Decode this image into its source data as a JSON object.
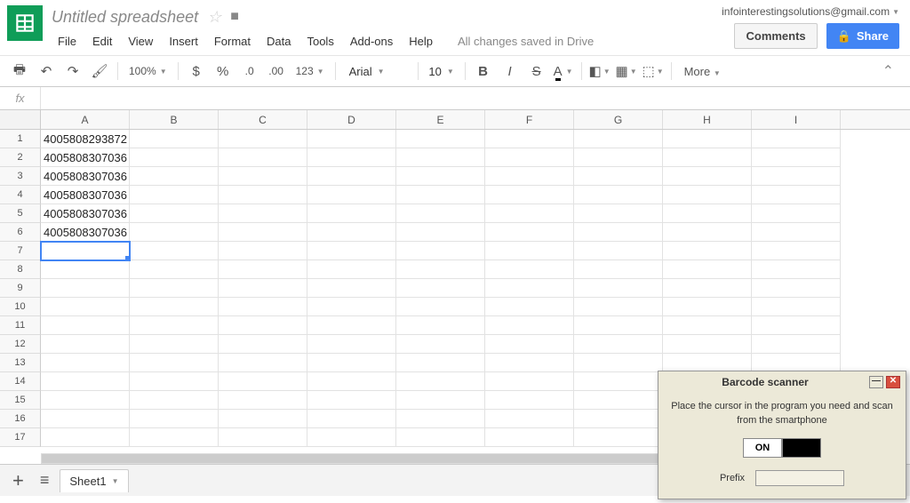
{
  "doc_title": "Untitled spreadsheet",
  "user_email": "infointerestingsolutions@gmail.com",
  "buttons": {
    "comments": "Comments",
    "share": "Share"
  },
  "menus": [
    "File",
    "Edit",
    "View",
    "Insert",
    "Format",
    "Data",
    "Tools",
    "Add-ons",
    "Help"
  ],
  "save_status": "All changes saved in Drive",
  "toolbar": {
    "zoom": "100%",
    "currency": "$",
    "percent": "%",
    "dec_less": ".0",
    "dec_more": ".00",
    "numfmt": "123",
    "font": "Arial",
    "size": "10",
    "more": "More"
  },
  "fx_label": "fx",
  "columns": [
    "A",
    "B",
    "C",
    "D",
    "E",
    "F",
    "G",
    "H",
    "I"
  ],
  "rows": [
    {
      "n": "1",
      "a": "4005808293872"
    },
    {
      "n": "2",
      "a": "4005808307036"
    },
    {
      "n": "3",
      "a": "4005808307036"
    },
    {
      "n": "4",
      "a": "4005808307036"
    },
    {
      "n": "5",
      "a": "4005808307036"
    },
    {
      "n": "6",
      "a": "4005808307036"
    },
    {
      "n": "7",
      "a": ""
    },
    {
      "n": "8",
      "a": ""
    },
    {
      "n": "9",
      "a": ""
    },
    {
      "n": "10",
      "a": ""
    },
    {
      "n": "11",
      "a": ""
    },
    {
      "n": "12",
      "a": ""
    },
    {
      "n": "13",
      "a": ""
    },
    {
      "n": "14",
      "a": ""
    },
    {
      "n": "15",
      "a": ""
    },
    {
      "n": "16",
      "a": ""
    },
    {
      "n": "17",
      "a": ""
    }
  ],
  "selected_row": 7,
  "sheet_tab": "Sheet1",
  "scanner": {
    "title": "Barcode scanner",
    "message": "Place the cursor in the program you need and scan from the smartphone",
    "on": "ON",
    "prefix_label": "Prefix"
  }
}
